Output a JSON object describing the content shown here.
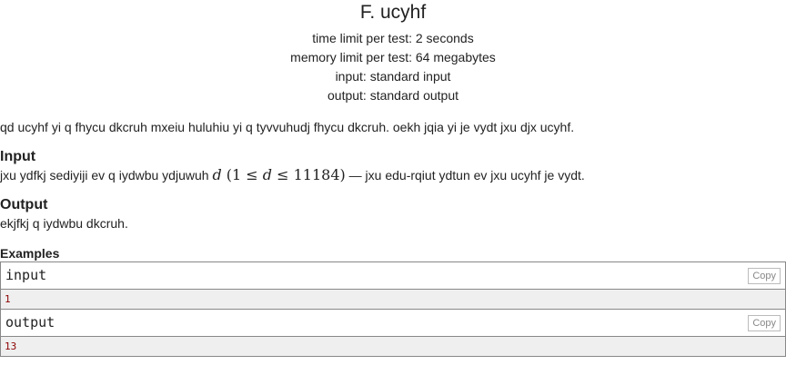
{
  "problem": {
    "title": "F. ucyhf",
    "time_limit": "time limit per test: 2 seconds",
    "memory_limit": "memory limit per test: 64 megabytes",
    "input_file": "input: standard input",
    "output_file": "output: standard output",
    "legend": "qd ucyhf yi q fhycu dkcruh mxeiu huluhiu yi q tyvvuhudj fhycu dkcruh. oekh jqia yi je vydt jxu djx ucyhf."
  },
  "input_section": {
    "title": "Input",
    "text_before": "jxu ydfkj sediyiji ev q iydwbu ydjuwuh ",
    "math_var": "d",
    "math_constraint_open": " (1 ≤ ",
    "math_constraint_var": "d",
    "math_constraint_close": " ≤ 11184)",
    "text_after": " — jxu edu-rqiut ydtun ev jxu ucyhf je vydt."
  },
  "output_section": {
    "title": "Output",
    "text": "ekjfkj q iydwbu dkcruh."
  },
  "examples": {
    "title": "Examples",
    "input_label": "input",
    "input_value": "1",
    "output_label": "output",
    "output_value": "13",
    "copy_label": "Copy"
  }
}
